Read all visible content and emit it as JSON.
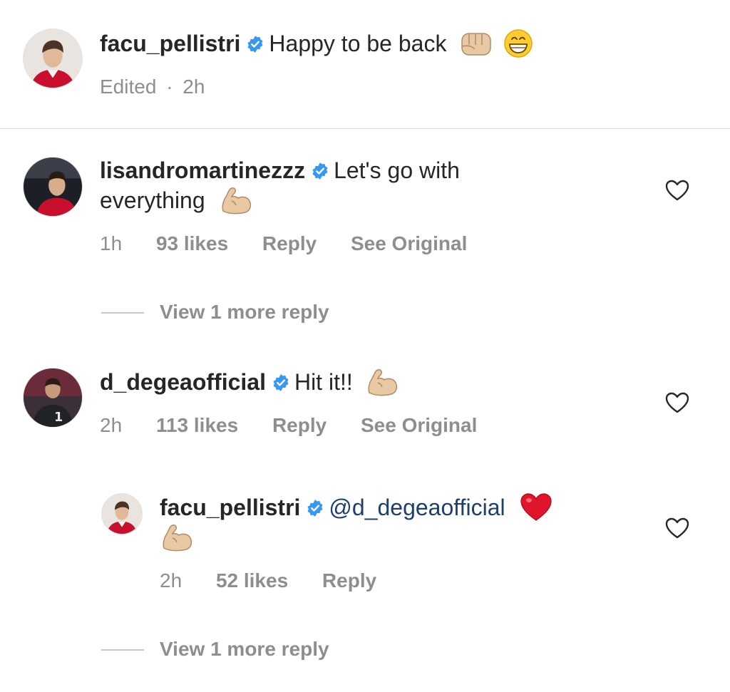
{
  "caption": {
    "username": "facu_pellistri",
    "text": "Happy to be back",
    "emojis": [
      "fist-emoji",
      "grin-emoji"
    ],
    "meta": {
      "edited": "Edited",
      "separator": "·",
      "time": "2h"
    }
  },
  "comments": [
    {
      "username": "lisandromartinezzz",
      "text_line1": "Let's go with",
      "text_line2": "everything",
      "emoji": "flexed-biceps-emoji",
      "time": "1h",
      "likes": "93 likes",
      "reply_label": "Reply",
      "see_original_label": "See Original",
      "view_more": "View 1 more reply"
    },
    {
      "username": "d_degeaofficial",
      "text": "Hit it!!",
      "emoji": "flexed-biceps-emoji",
      "time": "2h",
      "likes": "113 likes",
      "reply_label": "Reply",
      "see_original_label": "See Original",
      "reply": {
        "username": "facu_pellistri",
        "mention": "@d_degeaofficial",
        "emojis": [
          "red-heart-emoji",
          "flexed-biceps-emoji"
        ],
        "time": "2h",
        "likes": "52 likes",
        "reply_label": "Reply"
      },
      "view_more": "View 1 more reply"
    }
  ],
  "colors": {
    "text": "#262626",
    "meta": "#8e8e8e",
    "verified": "#3897f0",
    "mention": "#1d3f6e",
    "divider": "#dbdbdb"
  }
}
